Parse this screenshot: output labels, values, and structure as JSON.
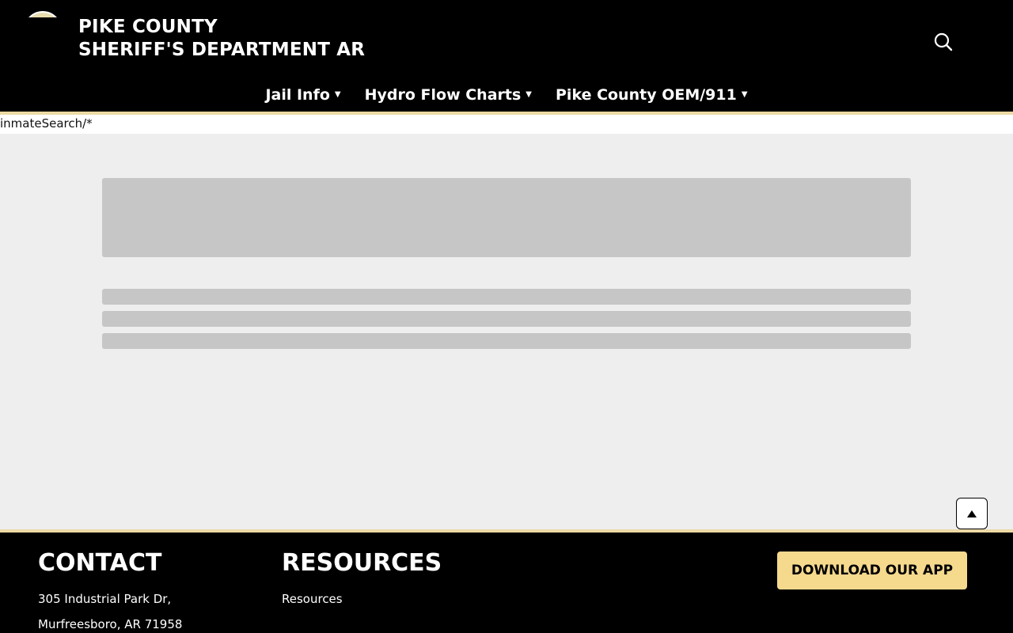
{
  "header": {
    "title_line1": "PIKE COUNTY",
    "title_line2": "SHERIFF'S DEPARTMENT AR",
    "search_icon": "search-icon"
  },
  "nav": {
    "items": [
      {
        "label": "Jail Info"
      },
      {
        "label": "Hydro Flow Charts"
      },
      {
        "label": "Pike County OEM/911"
      }
    ]
  },
  "url_text": "inmateSearch/*",
  "footer": {
    "contact_heading": "CONTACT",
    "address_line1": "305 Industrial Park Dr,",
    "address_line2": "Murfreesboro, AR 71958",
    "resources_heading": "RESOURCES",
    "resources_link": "Resources",
    "app_button": "DOWNLOAD OUR APP"
  },
  "colors": {
    "header_bg": "#000000",
    "accent_gold": "#ecd9a4",
    "app_button_bg": "#f5d98d",
    "content_bg": "#eeeeee",
    "skeleton": "#c6c6c6"
  }
}
